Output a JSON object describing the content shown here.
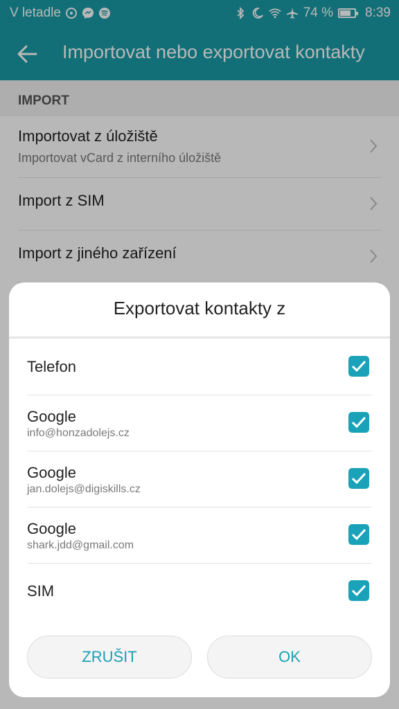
{
  "status_bar": {
    "carrier": "V letadle",
    "battery": "74 %",
    "battery_level": 0.74,
    "time": "8:39",
    "icons_left": [
      "sync-icon",
      "messenger-icon",
      "spotify-icon"
    ],
    "icons_right": [
      "bluetooth-icon",
      "moon-icon",
      "wifi-icon",
      "airplane-icon",
      "battery-icon"
    ]
  },
  "toolbar": {
    "back_icon": "arrow-left-icon",
    "title": "Importovat nebo exportovat kontakty",
    "color": "#1a9aa5"
  },
  "import_section": {
    "header": "IMPORT",
    "items": [
      {
        "title": "Importovat z úložiště",
        "subtitle": "Importovat vCard z interního úložiště"
      },
      {
        "title": "Import z SIM"
      },
      {
        "title": "Import z jiného zařízení"
      }
    ]
  },
  "dialog": {
    "title": "Exportovat kontakty z",
    "options": [
      {
        "name": "Telefon",
        "checked": true
      },
      {
        "name": "Google",
        "account": "info@honzadolejs.cz",
        "checked": true
      },
      {
        "name": "Google",
        "account": "jan.dolejs@digiskills.cz",
        "checked": true
      },
      {
        "name": "Google",
        "account": "shark.jdd@gmail.com",
        "checked": true
      },
      {
        "name": "SIM",
        "checked": true
      }
    ],
    "cancel_label": "ZRUŠIT",
    "ok_label": "OK",
    "accent": "#1aa3b8"
  }
}
